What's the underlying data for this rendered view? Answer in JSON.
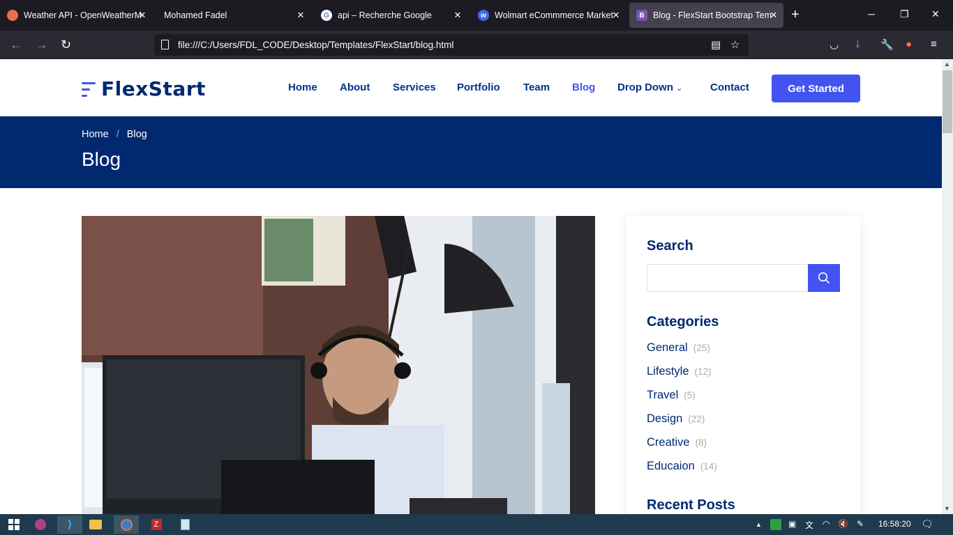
{
  "browser": {
    "tabs": [
      {
        "title": "Weather API - OpenWeatherMa",
        "favicon": "weather-favicon",
        "color": "#e96e4c"
      },
      {
        "title": "Mohamed Fadel",
        "favicon": "none",
        "color": ""
      },
      {
        "title": "api – Recherche Google",
        "favicon": "google-favicon",
        "color": "#4285f4"
      },
      {
        "title": "Wolmart eCommmerce Market",
        "favicon": "wolmart-favicon",
        "color": "#3b6cf0"
      },
      {
        "title": "Blog - FlexStart Bootstrap Temp",
        "favicon": "bootstrap-favicon",
        "color": "#7952b3"
      }
    ],
    "active_tab": 4,
    "url": "file:///C:/Users/FDL_CODE/Desktop/Templates/FlexStart/blog.html"
  },
  "site": {
    "logo": "FlexStart",
    "nav": [
      {
        "label": "Home"
      },
      {
        "label": "About"
      },
      {
        "label": "Services"
      },
      {
        "label": "Portfolio"
      },
      {
        "label": "Team"
      },
      {
        "label": "Blog"
      },
      {
        "label": "Drop Down"
      },
      {
        "label": "Contact"
      }
    ],
    "active_nav": "Blog",
    "cta": "Get Started",
    "accent": "#4154f1",
    "navy": "#012970"
  },
  "breadcrumb": {
    "home": "Home",
    "separator": "/",
    "current": "Blog"
  },
  "page_title": "Blog",
  "sidebar": {
    "search_title": "Search",
    "search_placeholder": "",
    "categories_title": "Categories",
    "categories": [
      {
        "name": "General",
        "count": "(25)"
      },
      {
        "name": "Lifestyle",
        "count": "(12)"
      },
      {
        "name": "Travel",
        "count": "(5)"
      },
      {
        "name": "Design",
        "count": "(22)"
      },
      {
        "name": "Creative",
        "count": "(8)"
      },
      {
        "name": "Educaion",
        "count": "(14)"
      }
    ],
    "recent_posts_title": "Recent Posts"
  },
  "taskbar": {
    "clock": "16:58:20"
  }
}
